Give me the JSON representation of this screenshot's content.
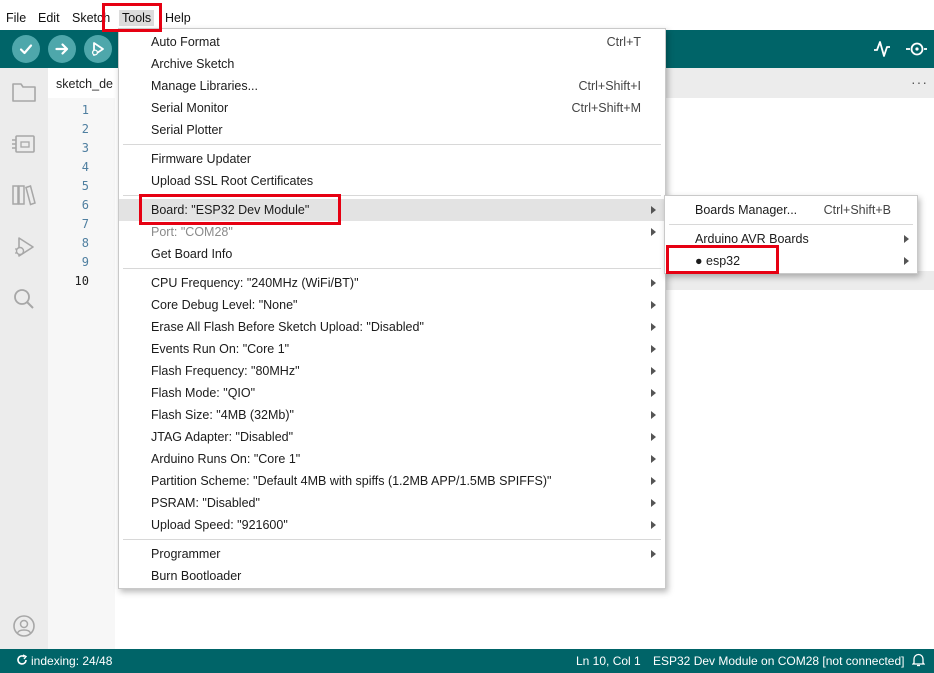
{
  "menubar": {
    "items": [
      "File",
      "Edit",
      "Sketch",
      "Tools",
      "Help"
    ]
  },
  "toolbar": {
    "buttons": [
      "verify-icon",
      "upload-icon",
      "debug-icon"
    ],
    "right": [
      "serial-plotter-icon",
      "serial-monitor-icon"
    ]
  },
  "sidebar": {
    "icons": [
      "folder-icon",
      "board-icon",
      "library-icon",
      "debug-icon",
      "search-icon",
      "account-icon"
    ]
  },
  "tab": {
    "label": "sketch_de",
    "more": "···"
  },
  "gutter": {
    "lines": [
      "1",
      "2",
      "3",
      "4",
      "5",
      "6",
      "7",
      "8",
      "9",
      "10"
    ]
  },
  "tools_menu": {
    "groups": [
      [
        {
          "label": "Auto Format",
          "shortcut": "Ctrl+T"
        },
        {
          "label": "Archive Sketch"
        },
        {
          "label": "Manage Libraries...",
          "shortcut": "Ctrl+Shift+I"
        },
        {
          "label": "Serial Monitor",
          "shortcut": "Ctrl+Shift+M"
        },
        {
          "label": "Serial Plotter"
        }
      ],
      [
        {
          "label": "Firmware Updater"
        },
        {
          "label": "Upload SSL Root Certificates"
        }
      ],
      [
        {
          "label": "Board: \"ESP32 Dev Module\"",
          "submenu": true
        },
        {
          "label": "Port: \"COM28\"",
          "submenu": true,
          "disabled": true
        },
        {
          "label": "Get Board Info"
        }
      ],
      [
        {
          "label": "CPU Frequency: \"240MHz (WiFi/BT)\"",
          "submenu": true
        },
        {
          "label": "Core Debug Level: \"None\"",
          "submenu": true
        },
        {
          "label": "Erase All Flash Before Sketch Upload: \"Disabled\"",
          "submenu": true
        },
        {
          "label": "Events Run On: \"Core 1\"",
          "submenu": true
        },
        {
          "label": "Flash Frequency: \"80MHz\"",
          "submenu": true
        },
        {
          "label": "Flash Mode: \"QIO\"",
          "submenu": true
        },
        {
          "label": "Flash Size: \"4MB (32Mb)\"",
          "submenu": true
        },
        {
          "label": "JTAG Adapter: \"Disabled\"",
          "submenu": true
        },
        {
          "label": "Arduino Runs On: \"Core 1\"",
          "submenu": true
        },
        {
          "label": "Partition Scheme: \"Default 4MB with spiffs (1.2MB APP/1.5MB SPIFFS)\"",
          "submenu": true
        },
        {
          "label": "PSRAM: \"Disabled\"",
          "submenu": true
        },
        {
          "label": "Upload Speed: \"921600\"",
          "submenu": true
        }
      ],
      [
        {
          "label": "Programmer",
          "submenu": true
        },
        {
          "label": "Burn Bootloader"
        }
      ]
    ]
  },
  "boards_menu": {
    "groups": [
      [
        {
          "label": "Boards Manager...",
          "shortcut": "Ctrl+Shift+B"
        }
      ],
      [
        {
          "label": "Arduino AVR Boards",
          "submenu": true
        },
        {
          "label": "● esp32",
          "submenu": true
        }
      ]
    ]
  },
  "statusbar": {
    "indexing": "indexing: 24/48",
    "position": "Ln 10, Col 1",
    "board": "ESP32 Dev Module on COM28 [not connected]"
  },
  "colors": {
    "teal": "#006468",
    "teal_button": "#4ea7ab",
    "annotation_red": "#e60012"
  }
}
